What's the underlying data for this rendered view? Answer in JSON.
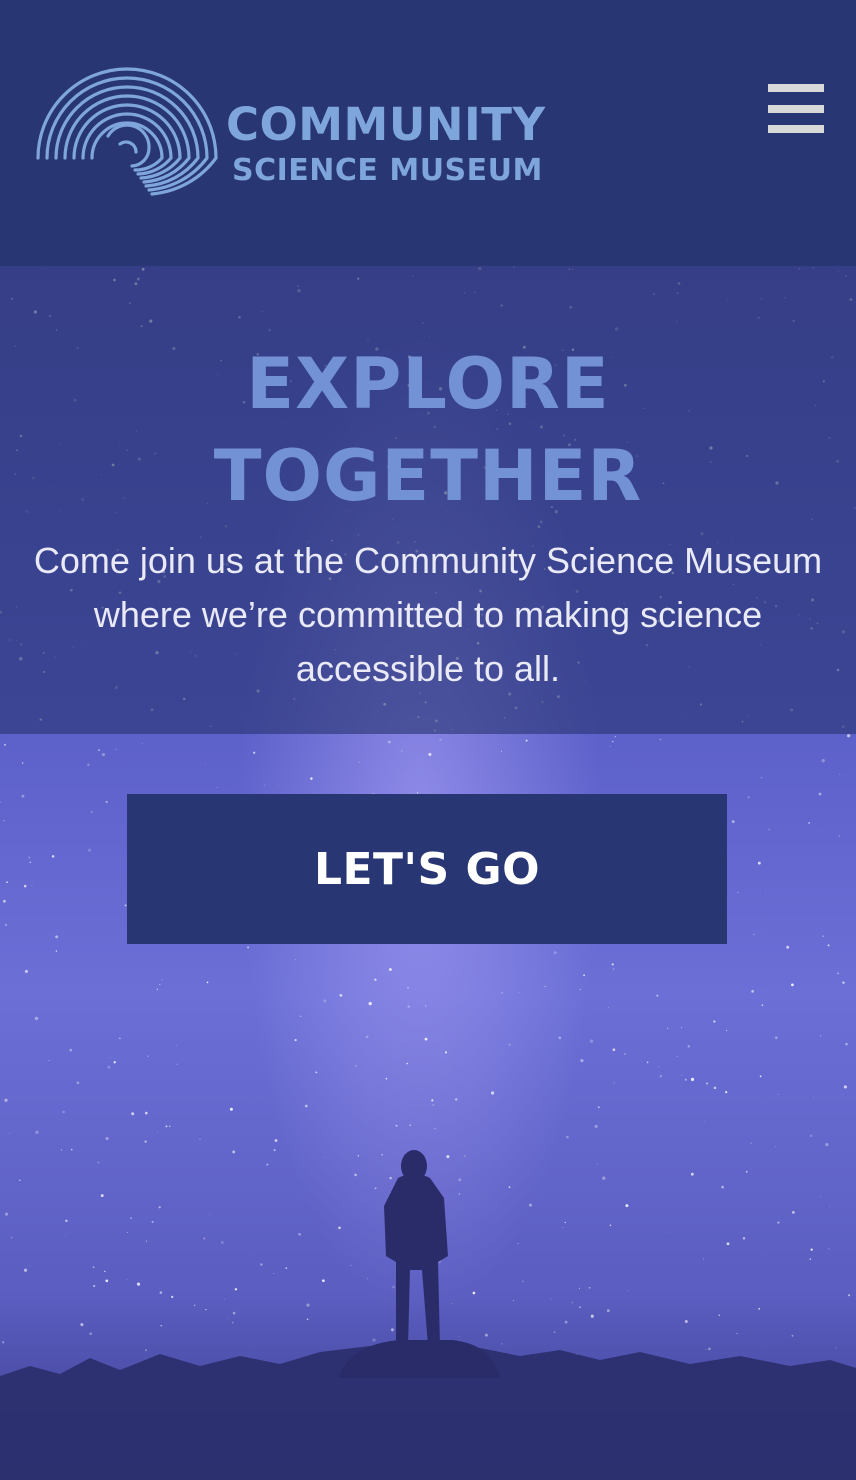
{
  "header": {
    "logo": {
      "line1": "COMMUNITY",
      "line2": "SCIENCE MUSEUM"
    },
    "menu_icon": "hamburger-menu-icon"
  },
  "hero": {
    "title_line1": "EXPLORE",
    "title_line2": "TOGETHER",
    "text": "Come join us at the Community Science Museum where we’re committed to making science accessible to all.",
    "cta_label": "LET'S GO"
  },
  "colors": {
    "header_bg": "#283673",
    "logo": "#7fa6dc",
    "title": "#7392d6",
    "button_bg": "#283673",
    "button_text": "#ffffff"
  }
}
